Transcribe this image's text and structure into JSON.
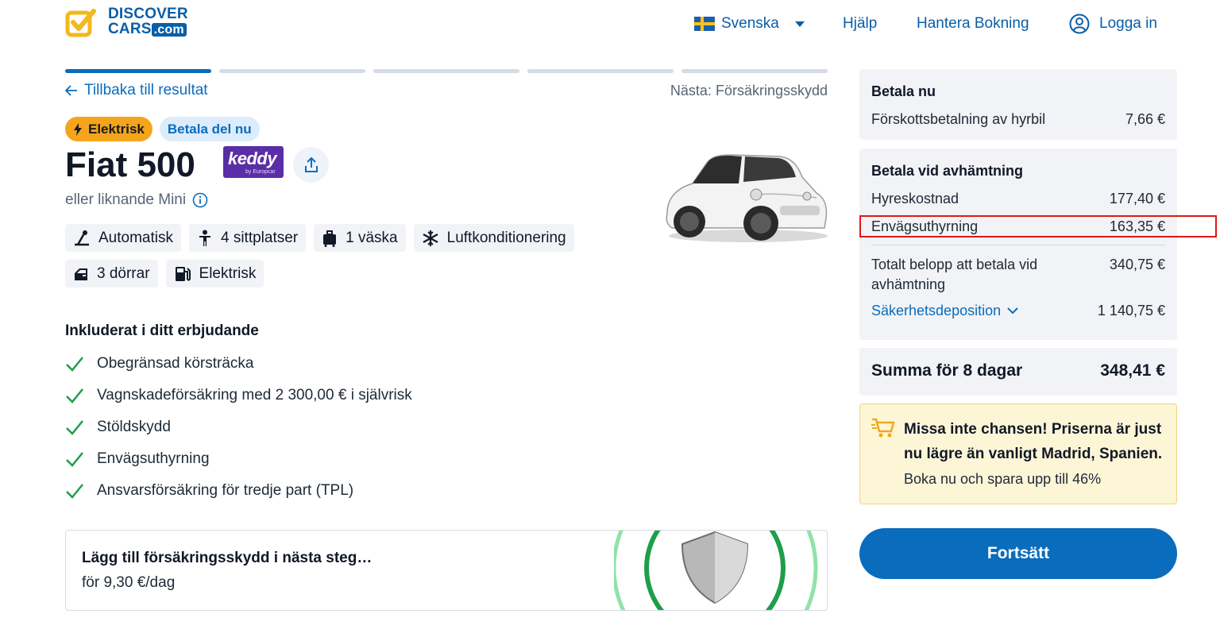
{
  "header": {
    "logo": {
      "line1": "DISCOVER",
      "line2": "CARS",
      "suffix": ".com"
    },
    "language": "Svenska",
    "help": "Hjälp",
    "manage_booking": "Hantera Bokning",
    "login": "Logga in"
  },
  "progress": {
    "steps_total": 5,
    "active_step": 1
  },
  "nav": {
    "back": "Tillbaka till resultat",
    "next": "Nästa: Försäkringsskydd"
  },
  "badges": {
    "electric": "Elektrisk",
    "pay_part": "Betala del nu"
  },
  "car": {
    "name": "Fiat 500",
    "supplier_logo": {
      "word": "keddy",
      "sub": "by Europcar"
    },
    "similar": "eller liknande Mini",
    "specs": [
      "Automatisk",
      "4 sittplatser",
      "1 väska",
      "Luftkonditionering",
      "3 dörrar",
      "Elektrisk"
    ]
  },
  "included": {
    "title": "Inkluderat i ditt erbjudande",
    "items": [
      "Obegränsad körsträcka",
      "Vagnskadeförsäkring med 2 300,00 € i självrisk",
      "Stöldskydd",
      "Envägsuthyrning",
      "Ansvarsförsäkring för tredje part (TPL)"
    ]
  },
  "insurance": {
    "title": "Lägg till försäkringsskydd i nästa steg…",
    "price": "för 9,30 €/dag"
  },
  "pay_now": {
    "title": "Betala nu",
    "rows": [
      {
        "label": "Förskottsbetalning av hyrbil",
        "amount": "7,66 €"
      }
    ]
  },
  "pay_pickup": {
    "title": "Betala vid avhämtning",
    "rows": [
      {
        "label": "Hyreskostnad",
        "amount": "177,40 €"
      },
      {
        "label": "Envägsuthyrning",
        "amount": "163,35 €"
      }
    ],
    "total_label": "Totalt belopp att betala vid avhämtning",
    "total_amount": "340,75 €",
    "deposit_label": "Säkerhetsdeposition",
    "deposit_amount": "1 140,75 €"
  },
  "summary": {
    "label": "Summa för 8 dagar",
    "amount": "348,41 €"
  },
  "promo": {
    "title": "Missa inte chansen! Priserna är just nu lägre än vanligt Madrid, Spanien.",
    "subtitle": "Boka nu och spara upp till 46%"
  },
  "cta": "Fortsätt",
  "colors": {
    "brand": "#0a6cbd",
    "electric_badge": "#f4a51c",
    "check": "#1e9e4a",
    "highlight": "#e01818"
  }
}
